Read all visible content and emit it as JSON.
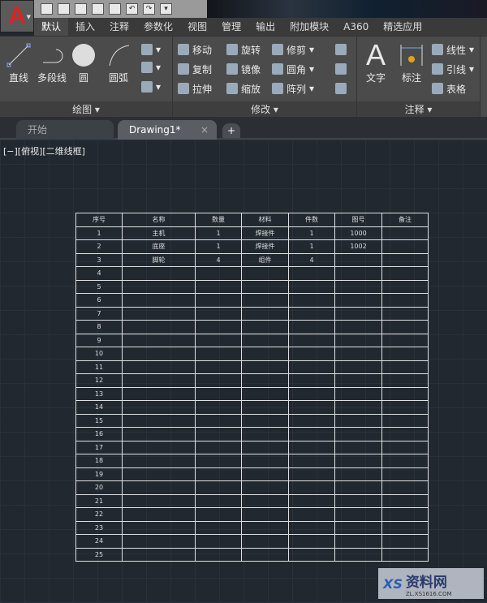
{
  "app": {
    "logo": "A"
  },
  "ribbon_tabs": [
    "默认",
    "插入",
    "注释",
    "参数化",
    "视图",
    "管理",
    "输出",
    "附加模块",
    "A360",
    "精选应用"
  ],
  "draw_panel": {
    "label": "绘图",
    "tools": [
      "直线",
      "多段线",
      "圆",
      "圆弧"
    ]
  },
  "modify_panel": {
    "label": "修改",
    "tools": [
      "移动",
      "旋转",
      "修剪",
      "复制",
      "镜像",
      "圆角",
      "拉伸",
      "缩放",
      "阵列"
    ]
  },
  "annotation_panel": {
    "label": "注释",
    "tools": [
      "文字",
      "标注",
      "线性",
      "引线",
      "表格"
    ]
  },
  "doc_tabs": {
    "start": "开始",
    "drawing": "Drawing1*",
    "close": "×",
    "add": "+"
  },
  "viewport_label": "[−][俯视][二维线框]",
  "table": {
    "headers": [
      "序号",
      "名称",
      "数量",
      "材料",
      "件数",
      "图号",
      "备注"
    ],
    "rows": [
      [
        "1",
        "主机",
        "1",
        "焊接件",
        "1",
        "1000",
        ""
      ],
      [
        "2",
        "底座",
        "1",
        "焊接件",
        "1",
        "1002",
        ""
      ],
      [
        "3",
        "脚轮",
        "4",
        "组件",
        "4",
        "",
        ""
      ],
      [
        "4",
        "",
        "",
        "",
        "",
        "",
        ""
      ],
      [
        "5",
        "",
        "",
        "",
        "",
        "",
        ""
      ],
      [
        "6",
        "",
        "",
        "",
        "",
        "",
        ""
      ],
      [
        "7",
        "",
        "",
        "",
        "",
        "",
        ""
      ],
      [
        "8",
        "",
        "",
        "",
        "",
        "",
        ""
      ],
      [
        "9",
        "",
        "",
        "",
        "",
        "",
        ""
      ],
      [
        "10",
        "",
        "",
        "",
        "",
        "",
        ""
      ],
      [
        "11",
        "",
        "",
        "",
        "",
        "",
        ""
      ],
      [
        "12",
        "",
        "",
        "",
        "",
        "",
        ""
      ],
      [
        "13",
        "",
        "",
        "",
        "",
        "",
        ""
      ],
      [
        "14",
        "",
        "",
        "",
        "",
        "",
        ""
      ],
      [
        "15",
        "",
        "",
        "",
        "",
        "",
        ""
      ],
      [
        "16",
        "",
        "",
        "",
        "",
        "",
        ""
      ],
      [
        "17",
        "",
        "",
        "",
        "",
        "",
        ""
      ],
      [
        "18",
        "",
        "",
        "",
        "",
        "",
        ""
      ],
      [
        "19",
        "",
        "",
        "",
        "",
        "",
        ""
      ],
      [
        "20",
        "",
        "",
        "",
        "",
        "",
        ""
      ],
      [
        "21",
        "",
        "",
        "",
        "",
        "",
        ""
      ],
      [
        "22",
        "",
        "",
        "",
        "",
        "",
        ""
      ],
      [
        "23",
        "",
        "",
        "",
        "",
        "",
        ""
      ],
      [
        "24",
        "",
        "",
        "",
        "",
        "",
        ""
      ],
      [
        "25",
        "",
        "",
        "",
        "",
        "",
        ""
      ]
    ]
  },
  "watermark": {
    "logo": "XS",
    "name": "资料网",
    "url": "ZL.XS1616.COM"
  }
}
